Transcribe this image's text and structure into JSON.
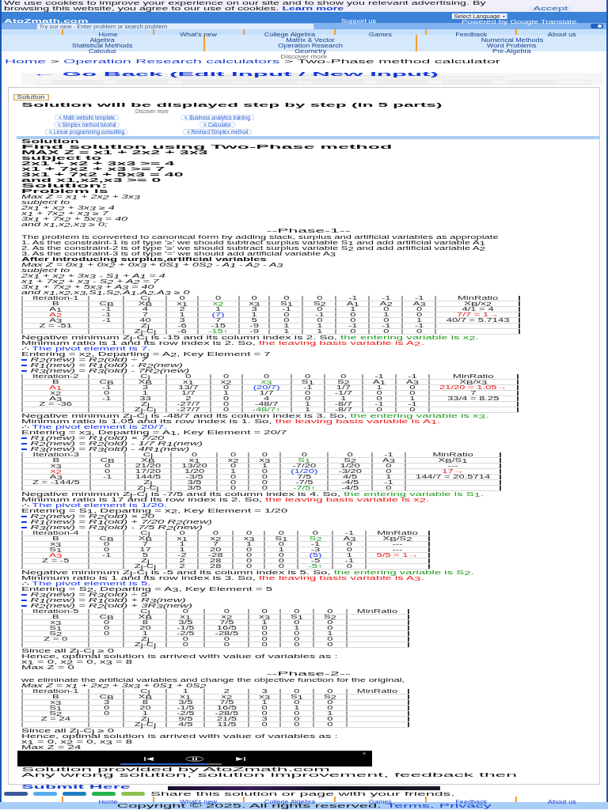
{
  "cookie_banner": {
    "text": "We use cookies to improve your experience on our site and to show you relevant advertising. By browsing this website, you agree to our use of cookies.",
    "link": "Learn more",
    "button": "Accept"
  },
  "header": {
    "logo": "AtoZmath.com",
    "support_link": "Support us",
    "language_select": "Select Language",
    "powered_by": "Powered by Google Translate",
    "search": {
      "placeholder": "Try our new - Enter problem or search problem"
    },
    "toggle": {
      "on": true
    }
  },
  "nav": {
    "top_row": [
      "Home",
      "What's new",
      "College Algebra",
      "Games",
      "Feedback",
      "About us"
    ],
    "grid": [
      [
        "Algebra",
        "Matrix & Vector",
        "Numerical Methods"
      ],
      [
        "Statistical Methods",
        "Operation Research",
        "Word Problems"
      ],
      [
        "Calculus",
        "Geometry",
        "Pre-Algebra"
      ]
    ],
    "discover": "Discover more"
  },
  "breadcrumb": [
    {
      "text": "Home",
      "kind": "link"
    },
    {
      "text": ">",
      "kind": "separator"
    },
    {
      "text": "Operation Research calculators",
      "kind": "link"
    },
    {
      "text": ">",
      "kind": "separator"
    },
    {
      "text": "Two-Phase method calculator",
      "kind": "current"
    }
  ],
  "go_back": "← Go Back (Edit Input / New Input)",
  "solution": {
    "tab": "Solution",
    "intro": "Solution will be displayed step by step (in 5 parts)",
    "discover": "Discover more",
    "suggestions": [
      "Math website template",
      "Business analytics training",
      "Simplex method tutorial",
      "Calculator",
      "Linear programming consulting",
      "Revised Simplex method"
    ],
    "heading": "Solution",
    "problem": {
      "title": "Find solution using Two-Phase method",
      "lines": [
        "MAX Z = x1 + 2x2 + 3x3",
        "subject to",
        "2x1 + x2 + 3x3 >= 4",
        "x1 + 7x2 + x3 >= 7",
        "3x1 + 7x2 + 5x3 = 40",
        "and x1,x2,x3 >= 0"
      ]
    },
    "solution_label": "Solution:",
    "problem_is": "Problem is",
    "formatted": [
      "Max Z = x$_{1}$ + 2x$_{2}$ + 3x$_{3}$",
      "subject to",
      "2x$_{1}$ + x$_{2}$ + 3x$_{3}$ ≥ 4",
      "x$_{1}$ + 7x$_{2}$ + x$_{3}$ ≥ 7",
      "3x$_{1}$ + 7x$_{2}$ + 5x$_{3}$ = 40",
      "and x$_{1}$,x$_{2}$,x$_{3}$ ≥ 0;"
    ],
    "phases": [
      {
        "title": "--Phase-1--",
        "intro": "The problem is converted to canonical form by adding slack, surplus and artificial variables as appropiate",
        "steps": [
          "1. As the constraint-1 is of type '≥' we should subtract surplus variable S$_{1}$ and add artificial variable A$_{1}$",
          "2. As the constraint-2 is of type '≥' we should subtract surplus variable S$_{2}$ and add artificial variable A$_{2}$",
          "3. As the constraint-3 is of type '=' we should add artificial variable A$_{3}$"
        ],
        "after_title": "After introducing surplus,artificial variables",
        "model": [
          "Max Z = 0x$_{1}$ + 0x$_{2}$ + 0x$_{3}$ + 0S$_{1}$ + 0S$_{2}$ - A$_{1}$ - A$_{2}$ - A$_{3}$",
          "subject to",
          "2x$_{1}$ + x$_{2}$ + 3x$_{3}$ - S$_{1}$ + A$_{1}$ = 4",
          "x$_{1}$ + 7x$_{2}$ + x$_{3}$ - S$_{2}$ + A$_{2}$ = 7",
          "3x$_{1}$ + 7x$_{2}$ + 5x$_{3}$ + A$_{3}$ = 40",
          "and x$_{1}$,x$_{2}$,x$_{3}$,S$_{1}$,S$_{2}$,A$_{1}$,A$_{2}$,A$_{3}$ ≥ 0"
        ],
        "iterations": [
          {
            "table": {
              "title": "Iteration-1",
              "cj_label": "C$_{j}$",
              "cj": [
                "0",
                "0",
                "0",
                "0",
                "0",
                "-1",
                "-1",
                "-1"
              ],
              "ratio_title": "MinRatio",
              "heads": [
                "B",
                "C$_{B}$",
                "X$_{B}$"
              ],
              "columns": [
                {
                  "name": "x$_{1}$",
                  "entering": false
                },
                {
                  "name": "x$_{2}$",
                  "entering": true
                },
                {
                  "name": "x$_{3}$",
                  "entering": false
                },
                {
                  "name": "S$_{1}$",
                  "entering": false
                },
                {
                  "name": "S$_{2}$",
                  "entering": false
                },
                {
                  "name": "A$_{1}$",
                  "entering": false
                },
                {
                  "name": "A$_{2}$",
                  "entering": false
                },
                {
                  "name": "A$_{3}$",
                  "entering": false
                }
              ],
              "ratio_label": "X$_{B}$/x$_{2}$",
              "rows": [
                {
                  "basis": "A$_{1}$",
                  "cb": "-1",
                  "xb": "4",
                  "cells": [
                    "2",
                    "1",
                    "3",
                    "-1",
                    "0",
                    "1",
                    "0",
                    "0"
                  ],
                  "ratio": "4/1 = 4",
                  "leaving": false
                },
                {
                  "basis": "A$_{2}$",
                  "cb": "-1",
                  "xb": "7",
                  "cells": [
                    "1",
                    "(7)",
                    "1",
                    "0",
                    "-1",
                    "0",
                    "1",
                    "0"
                  ],
                  "ratio": "7/7 = 1→",
                  "leaving": true
                },
                {
                  "basis": "A$_{3}$",
                  "cb": "-1",
                  "xb": "40",
                  "cells": [
                    "3",
                    "7",
                    "5",
                    "0",
                    "0",
                    "0",
                    "0",
                    "1"
                  ],
                  "ratio": "40/7 = 5.7143",
                  "leaving": false
                }
              ],
              "z": "Z = -51",
              "zj_label": "Z$_{j}$",
              "zj": [
                "-6",
                "-15",
                "-9",
                "1",
                "1",
                "-1",
                "-1",
                "-1"
              ],
              "zj_cj_label": "Z$_{j}$-C$_{j}$",
              "zj_cj": [
                "-6",
                "-15↑",
                "-9",
                "1",
                "1",
                "0",
                "0",
                "0"
              ]
            },
            "notes": {
              "entering_text": "Negative minimum Z$_{j}$-C$_{j}$ is -15 and its column index is 2. So,",
              "entering_result": "the entering variable is x$_{2}$.",
              "leaving_text": "Minimum ratio is 1 and its row index is 2. So,",
              "leaving_result": "the leaving basis variable is A$_{2}$.",
              "pivot_mark": "∴",
              "pivot_text": "The pivot element is 7.",
              "summary": "Entering = x$_{2}$, Departing = A$_{2}$, Key Element = 7",
              "operations": [
                "R$_{2}$(new) = R$_{2}$(old) ÷ 7",
                "R$_{1}$(new) = R$_{1}$(old) - R$_{2}$(new)",
                "R$_{3}$(new) = R$_{3}$(old) - 7R$_{2}$(new)"
              ]
            }
          },
          {
            "table": {
              "title": "Iteration-2",
              "cj_label": "C$_{j}$",
              "cj": [
                "0",
                "0",
                "0",
                "0",
                "0",
                "-1",
                "-1"
              ],
              "ratio_title": "MinRatio",
              "heads": [
                "B",
                "C$_{B}$",
                "X$_{B}$"
              ],
              "columns": [
                {
                  "name": "x$_{1}$",
                  "entering": false
                },
                {
                  "name": "x$_{2}$",
                  "entering": false
                },
                {
                  "name": "x$_{3}$",
                  "entering": true
                },
                {
                  "name": "S$_{1}$",
                  "entering": false
                },
                {
                  "name": "S$_{2}$",
                  "entering": false
                },
                {
                  "name": "A$_{1}$",
                  "entering": false
                },
                {
                  "name": "A$_{3}$",
                  "entering": false
                }
              ],
              "ratio_label": "X$_{B}$/x$_{3}$",
              "rows": [
                {
                  "basis": "A$_{1}$",
                  "cb": "-1",
                  "xb": "3",
                  "cells": [
                    "13/7",
                    "0",
                    "(20/7)",
                    "-1",
                    "1/7",
                    "1",
                    "0"
                  ],
                  "ratio": "21/20 = 1.05→",
                  "leaving": true
                },
                {
                  "basis": "x$_{2}$",
                  "cb": "0",
                  "xb": "1",
                  "cells": [
                    "1/7",
                    "1",
                    "1/7",
                    "0",
                    "-1/7",
                    "0",
                    "0"
                  ],
                  "ratio": "7",
                  "leaving": false
                },
                {
                  "basis": "A$_{3}$",
                  "cb": "-1",
                  "xb": "33",
                  "cells": [
                    "2",
                    "0",
                    "4",
                    "0",
                    "1",
                    "0",
                    "1"
                  ],
                  "ratio": "33/4 = 8.25",
                  "leaving": false
                }
              ],
              "z": "Z = -36",
              "zj_label": "Z$_{j}$",
              "zj": [
                "-27/7",
                "0",
                "-48/7",
                "1",
                "-8/7",
                "-1",
                "-1"
              ],
              "zj_cj_label": "Z$_{j}$-C$_{j}$",
              "zj_cj": [
                "-27/7",
                "0",
                "-48/7↑",
                "1",
                "-8/7",
                "0",
                "0"
              ]
            },
            "notes": {
              "entering_text": "Negative minimum Z$_{j}$-C$_{j}$ is -48/7 and its column index is 3. So,",
              "entering_result": "the entering variable is x$_{3}$.",
              "leaving_text": "Minimum ratio is 1.05 and its row index is 1. So,",
              "leaving_result": "the leaving basis variable is A$_{1}$.",
              "pivot_mark": "∴",
              "pivot_text": "The pivot element is 20/7.",
              "summary": "Entering = x$_{3}$, Departing = A$_{1}$, Key Element = 20/7",
              "operations": [
                "R$_{1}$(new) = R$_{1}$(old) × 7/20",
                "R$_{2}$(new) = R$_{2}$(old) - 1/7 R$_{1}$(new)",
                "R$_{3}$(new) = R$_{3}$(old) - 4R$_{1}$(new)"
              ]
            }
          },
          {
            "table": {
              "title": "Iteration-3",
              "cj_label": "C$_{j}$",
              "cj": [
                "0",
                "0",
                "0",
                "0",
                "0",
                "-1"
              ],
              "ratio_title": "MinRatio",
              "heads": [
                "B",
                "C$_{B}$",
                "X$_{B}$"
              ],
              "columns": [
                {
                  "name": "x$_{1}$",
                  "entering": false
                },
                {
                  "name": "x$_{2}$",
                  "entering": false
                },
                {
                  "name": "x$_{3}$",
                  "entering": false
                },
                {
                  "name": "S$_{1}$",
                  "entering": true
                },
                {
                  "name": "S$_{2}$",
                  "entering": false
                },
                {
                  "name": "A$_{3}$",
                  "entering": false
                }
              ],
              "ratio_label": "X$_{B}$/S$_{1}$",
              "rows": [
                {
                  "basis": "x$_{3}$",
                  "cb": "0",
                  "xb": "21/20",
                  "cells": [
                    "13/20",
                    "0",
                    "1",
                    "-7/20",
                    "1/20",
                    "0"
                  ],
                  "ratio": "---",
                  "leaving": false
                },
                {
                  "basis": "x$_{2}$",
                  "cb": "0",
                  "xb": "17/20",
                  "cells": [
                    "1/20",
                    "1",
                    "0",
                    "(1/20)",
                    "-3/20",
                    "0"
                  ],
                  "ratio": "17→",
                  "leaving": true
                },
                {
                  "basis": "A$_{3}$",
                  "cb": "-1",
                  "xb": "144/5",
                  "cells": [
                    "-3/5",
                    "0",
                    "0",
                    "7/5",
                    "4/5",
                    "1"
                  ],
                  "ratio": "144/7 = 20.5714",
                  "leaving": false
                }
              ],
              "z": "Z = -144/5",
              "zj_label": "Z$_{j}$",
              "zj": [
                "3/5",
                "0",
                "0",
                "-7/5",
                "-4/5",
                "-1"
              ],
              "zj_cj_label": "Z$_{j}$-C$_{j}$",
              "zj_cj": [
                "3/5",
                "0",
                "0",
                "-7/5↑",
                "-4/5",
                "0"
              ]
            },
            "notes": {
              "entering_text": "Negative minimum Z$_{j}$-C$_{j}$ is -7/5 and its column index is 4. So,",
              "entering_result": "the entering variable is S$_{1}$.",
              "leaving_text": "Minimum ratio is 17 and its row index is 2. So,",
              "leaving_result": "the leaving basis variable is x$_{2}$.",
              "pivot_mark": "∴",
              "pivot_text": "The pivot element is 1/20.",
              "summary": "Entering = S$_{1}$, Departing = x$_{2}$, Key Element = 1/20",
              "operations": [
                "R$_{2}$(new) = R$_{2}$(old) × 20",
                "R$_{1}$(new) = R$_{1}$(old) + 7/20 R$_{2}$(new)",
                "R$_{3}$(new) = R$_{3}$(old) - 7/5 R$_{2}$(new)"
              ]
            }
          },
          {
            "table": {
              "title": "Iteration-4",
              "cj_label": "C$_{j}$",
              "cj": [
                "0",
                "0",
                "0",
                "0",
                "0",
                "-1"
              ],
              "ratio_title": "MinRatio",
              "heads": [
                "B",
                "C$_{B}$",
                "X$_{B}$"
              ],
              "columns": [
                {
                  "name": "x$_{1}$",
                  "entering": false
                },
                {
                  "name": "x$_{2}$",
                  "entering": false
                },
                {
                  "name": "x$_{3}$",
                  "entering": false
                },
                {
                  "name": "S$_{1}$",
                  "entering": false
                },
                {
                  "name": "S$_{2}$",
                  "entering": true
                },
                {
                  "name": "A$_{3}$",
                  "entering": false
                }
              ],
              "ratio_label": "X$_{B}$/S$_{2}$",
              "rows": [
                {
                  "basis": "x$_{3}$",
                  "cb": "0",
                  "xb": "7",
                  "cells": [
                    "1",
                    "7",
                    "1",
                    "0",
                    "-1",
                    "0"
                  ],
                  "ratio": "---",
                  "leaving": false
                },
                {
                  "basis": "S$_{1}$",
                  "cb": "0",
                  "xb": "17",
                  "cells": [
                    "1",
                    "20",
                    "0",
                    "1",
                    "-3",
                    "0"
                  ],
                  "ratio": "---",
                  "leaving": false
                },
                {
                  "basis": "A$_{3}$",
                  "cb": "-1",
                  "xb": "5",
                  "cells": [
                    "-2",
                    "-28",
                    "0",
                    "0",
                    "(5)",
                    "1"
                  ],
                  "ratio": "5/5 = 1→",
                  "leaving": true
                }
              ],
              "z": "Z = -5",
              "zj_label": "Z$_{j}$",
              "zj": [
                "2",
                "28",
                "0",
                "0",
                "-5",
                "-1"
              ],
              "zj_cj_label": "Z$_{j}$-C$_{j}$",
              "zj_cj": [
                "2",
                "28",
                "0",
                "0",
                "-5↑",
                "0"
              ]
            },
            "notes": {
              "entering_text": "Negative minimum Z$_{j}$-C$_{j}$ is -5 and its column index is 5. So,",
              "entering_result": "the entering variable is S$_{2}$.",
              "leaving_text": "Minimum ratio is 1 and its row index is 3. So,",
              "leaving_result": "the leaving basis variable is A$_{3}$.",
              "pivot_mark": "∴",
              "pivot_text": "The pivot element is 5.",
              "summary": "Entering = S$_{2}$, Departing = A$_{3}$, Key Element = 5",
              "operations": [
                "R$_{3}$(new) = R$_{3}$(old) ÷ 5",
                "R$_{1}$(new) = R$_{1}$(old) + R$_{3}$(new)",
                "R$_{2}$(new) = R$_{2}$(old) + 3R$_{3}$(new)"
              ]
            }
          },
          {
            "table": {
              "title": "Iteration-5",
              "cj_label": "C$_{j}$",
              "cj": [
                "0",
                "0",
                "0",
                "0",
                "0"
              ],
              "ratio_title": "MinRatio",
              "heads": [
                "B",
                "C$_{B}$",
                "X$_{B}$"
              ],
              "columns": [
                {
                  "name": "x$_{1}$",
                  "entering": false
                },
                {
                  "name": "x$_{2}$",
                  "entering": false
                },
                {
                  "name": "x$_{3}$",
                  "entering": false
                },
                {
                  "name": "S$_{1}$",
                  "entering": false
                },
                {
                  "name": "S$_{2}$",
                  "entering": false
                }
              ],
              "rows": [
                {
                  "basis": "x$_{3}$",
                  "cb": "0",
                  "xb": "8",
                  "cells": [
                    "3/5",
                    "7/5",
                    "1",
                    "0",
                    "0"
                  ],
                  "leaving": false
                },
                {
                  "basis": "S$_{1}$",
                  "cb": "0",
                  "xb": "20",
                  "cells": [
                    "-1/5",
                    "16/5",
                    "0",
                    "1",
                    "0"
                  ],
                  "leaving": false
                },
                {
                  "basis": "S$_{2}$",
                  "cb": "0",
                  "xb": "1",
                  "cells": [
                    "-2/5",
                    "-28/5",
                    "0",
                    "0",
                    "1"
                  ],
                  "leaving": false
                }
              ],
              "z": "Z = 0",
              "zj_label": "Z$_{j}$",
              "zj": [
                "0",
                "0",
                "0",
                "0",
                "0"
              ],
              "zj_cj_label": "Z$_{j}$-C$_{j}$",
              "zj_cj": [
                "0",
                "0",
                "0",
                "0",
                "0"
              ]
            }
          }
        ],
        "conclusion": [
          "Since all Z$_{j}$-C$_{j}$ ≥ 0",
          "Hence, optimal solution is arrived with value of variables as :",
          "x$_{1}$ = 0, x$_{2}$ = 0, x$_{3}$ = 8",
          "Max Z = 0"
        ]
      },
      {
        "title": "--Phase-2--",
        "intro": "we eliminate the artificial variables and change the objective function for the original,",
        "model": [
          "Max Z = x$_{1}$ + 2x$_{2}$ + 3x$_{3}$ + 0S$_{1}$ + 0S$_{2}$"
        ],
        "iterations": [
          {
            "table": {
              "title": "Iteration-1",
              "cj_label": "C$_{j}$",
              "cj": [
                "1",
                "2",
                "3",
                "0",
                "0"
              ],
              "ratio_title": "MinRatio",
              "heads": [
                "B",
                "C$_{B}$",
                "X$_{B}$"
              ],
              "columns": [
                {
                  "name": "x$_{1}$",
                  "entering": false
                },
                {
                  "name": "x$_{2}$",
                  "entering": false
                },
                {
                  "name": "x$_{3}$",
                  "entering": false
                },
                {
                  "name": "S$_{1}$",
                  "entering": false
                },
                {
                  "name": "S$_{2}$",
                  "entering": false
                }
              ],
              "rows": [
                {
                  "basis": "x$_{3}$",
                  "cb": "3",
                  "xb": "8",
                  "cells": [
                    "3/5",
                    "7/5",
                    "1",
                    "0",
                    "0"
                  ],
                  "leaving": false
                },
                {
                  "basis": "S$_{1}$",
                  "cb": "0",
                  "xb": "20",
                  "cells": [
                    "-1/5",
                    "16/5",
                    "0",
                    "1",
                    "0"
                  ],
                  "leaving": false
                },
                {
                  "basis": "S$_{2}$",
                  "cb": "0",
                  "xb": "1",
                  "cells": [
                    "-2/5",
                    "-28/5",
                    "0",
                    "0",
                    "1"
                  ],
                  "leaving": false
                }
              ],
              "z": "Z = 24",
              "zj_label": "Z$_{j}$",
              "zj": [
                "9/5",
                "21/5",
                "3",
                "0",
                "0"
              ],
              "zj_cj_label": "Z$_{j}$-C$_{j}$",
              "zj_cj": [
                "4/5",
                "11/5",
                "0",
                "0",
                "0"
              ]
            }
          }
        ],
        "conclusion": [
          "Since all Z$_{j}$-C$_{j}$ ≥ 0",
          "Hence, optimal solution is arrived with value of variables as :",
          "x$_{1}$ = 0, x$_{2}$ = 0, x$_{3}$ = 8",
          "Max Z = 24"
        ]
      }
    ],
    "video": {
      "level": 0.85
    },
    "provided": "Solution provided by AtoZmath.com",
    "feedback": "Any wrong solution, solution improvement, feedback then",
    "submit": "Submit Here"
  },
  "share": {
    "buttons": [
      {
        "color": "#3b5998"
      },
      {
        "color": "#55acee"
      },
      {
        "color": "#1f7bc1"
      },
      {
        "color": "#25b34a"
      },
      {
        "color": "#8cc152"
      }
    ],
    "text": "Share this solution or page with your friends."
  },
  "footer": {
    "links": [
      "Home",
      "What's new",
      "College Algebra",
      "Games",
      "Feedback",
      "About us"
    ],
    "copyright": "Copyright © 2025. All rights reserved.",
    "legal_links": [
      "Terms,",
      "Privacy"
    ]
  }
}
